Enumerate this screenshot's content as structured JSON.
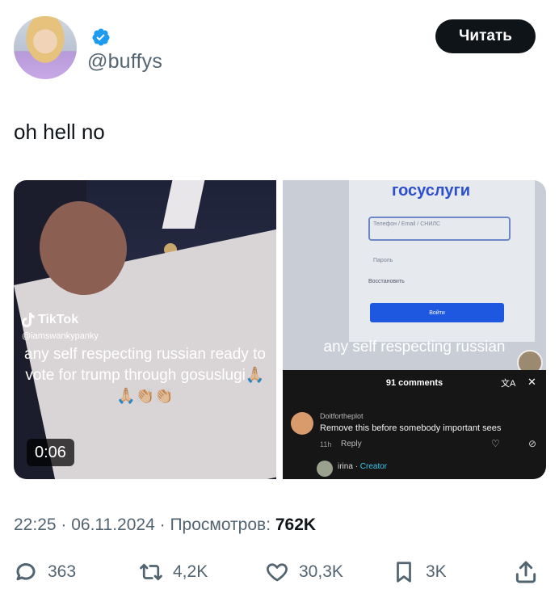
{
  "author": {
    "handle": "@buffys",
    "avatar_icon": "profile-avatar",
    "verified_icon": "verified-badge-icon",
    "verified_color": "#1d9bf0"
  },
  "header": {
    "read_button_label": "Читать"
  },
  "tweet": {
    "text": "oh hell no"
  },
  "media": {
    "left": {
      "tiktok_logo": "TikTok",
      "tiktok_user": "@iamswankypanky",
      "caption": "any self respecting russian ready to vote for trump through gosuslugi🙏🏼🙏🏼👏🏼👏🏼",
      "duration": "0:06"
    },
    "right": {
      "site_title": "госуслуги",
      "field_placeholder": "Телефон / Email / СНИЛС",
      "password_label": "Пароль",
      "restore_label": "Восстановить",
      "login_button": "Войти",
      "caption": "any self respecting russian",
      "comments": {
        "count_label": "91 comments",
        "first": {
          "user": "Doitfortheplot",
          "text": "Remove this before somebody important sees",
          "time": "11h",
          "reply": "Reply"
        },
        "second": {
          "user": "irina",
          "badge": "Creator"
        }
      }
    }
  },
  "meta": {
    "time": "22:25",
    "date": "06.11.2024",
    "views_label": "Просмотров:",
    "views_value": "762K"
  },
  "actions": {
    "replies": "363",
    "reposts": "4,2K",
    "likes": "30,3K",
    "bookmarks": "3K"
  }
}
